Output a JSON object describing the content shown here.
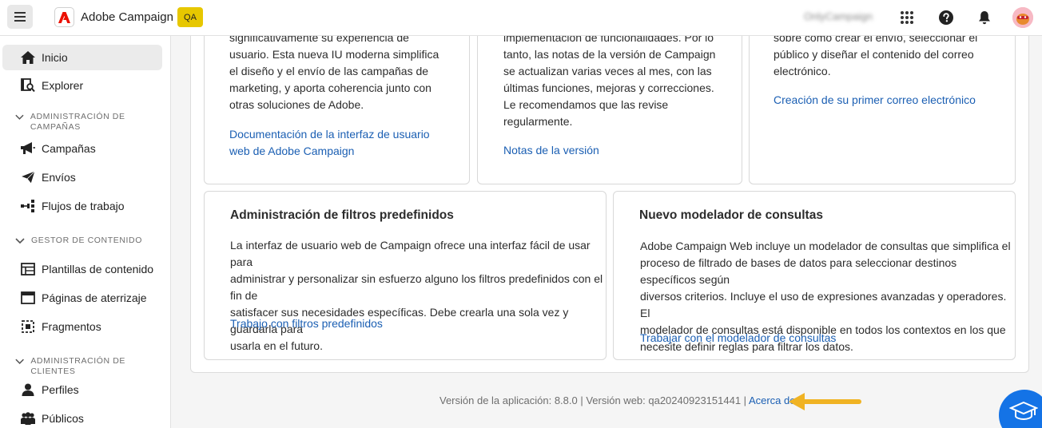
{
  "header": {
    "app_name": "Adobe Campaign",
    "env_badge": "QA",
    "org_name": "OnlyCampaign"
  },
  "sidebar": {
    "items": [
      {
        "label": "Inicio",
        "icon": "home-icon",
        "active": true
      },
      {
        "label": "Explorer",
        "icon": "explorer-icon"
      }
    ],
    "sections": [
      {
        "label": "Administración de campañas",
        "items": [
          {
            "label": "Campañas",
            "icon": "megaphone-icon"
          },
          {
            "label": "Envíos",
            "icon": "send-icon"
          },
          {
            "label": "Flujos de trabajo",
            "icon": "workflow-icon"
          }
        ]
      },
      {
        "label": "Gestor de contenido",
        "items": [
          {
            "label": "Plantillas de contenido",
            "icon": "template-icon"
          },
          {
            "label": "Páginas de aterrizaje",
            "icon": "landing-page-icon"
          },
          {
            "label": "Fragmentos",
            "icon": "fragment-icon"
          }
        ]
      },
      {
        "label": "Administración de clientes",
        "items": [
          {
            "label": "Perfiles",
            "icon": "user-icon"
          },
          {
            "label": "Públicos",
            "icon": "audience-icon"
          }
        ]
      }
    ]
  },
  "cards_top": [
    {
      "lines": [
        "significativamente su experiencia de",
        "usuario. Esta nueva IU moderna simplifica",
        "el diseño y el envío de las campañas de",
        "marketing, y aporta coherencia junto con",
        "otras soluciones de Adobe."
      ],
      "link_lines": [
        "Documentación de la interfaz de usuario",
        "web de Adobe Campaign"
      ]
    },
    {
      "lines": [
        "implementación de funcionalidades. Por lo",
        "tanto, las notas de la versión de Campaign",
        "se actualizan varias veces al mes, con las",
        "últimas funciones, mejoras y correcciones.",
        "Le recomendamos que las revise",
        "regularmente."
      ],
      "link_lines": [
        "Notas de la versión"
      ]
    },
    {
      "lines": [
        "sobre cómo crear el envío, seleccionar el",
        "público y diseñar el contenido del correo",
        "electrónico."
      ],
      "link_lines": [
        "Creación de su primer correo electrónico"
      ]
    }
  ],
  "cards_bottom": [
    {
      "title": "Administración de filtros predefinidos",
      "lines": [
        "La interfaz de usuario web de Campaign ofrece una interfaz fácil de usar para",
        "administrar y personalizar sin esfuerzo alguno los filtros predefinidos con el fin de",
        "satisfacer sus necesidades específicas. Debe crearla una sola vez y guardarla para",
        "usarla  en el futuro."
      ],
      "link": "Trabajo con filtros predefinidos"
    },
    {
      "title": "Nuevo modelador de consultas",
      "lines": [
        "Adobe Campaign Web incluye un  modelador de consultas que simplifica el",
        "proceso de filtrado de bases de datos para seleccionar destinos específicos según",
        "diversos criterios. Incluye el uso de expresiones avanzadas y operadores. El",
        "modelador de consultas está disponible en todos los contextos en los que",
        "necesite  definir reglas para filtrar los datos."
      ],
      "link": "Trabajar con el modelador de consultas"
    }
  ],
  "footer": {
    "version_text": "Versión de la aplicación: 8.8.0 | Versión web: qa20240923151441 | ",
    "about_link": "Acerca de"
  },
  "colors": {
    "accent": "#1473e6",
    "link": "#1b5fb3",
    "badge": "#e7c700",
    "adobe_red": "#eb1000",
    "arrow": "#f0b323"
  }
}
